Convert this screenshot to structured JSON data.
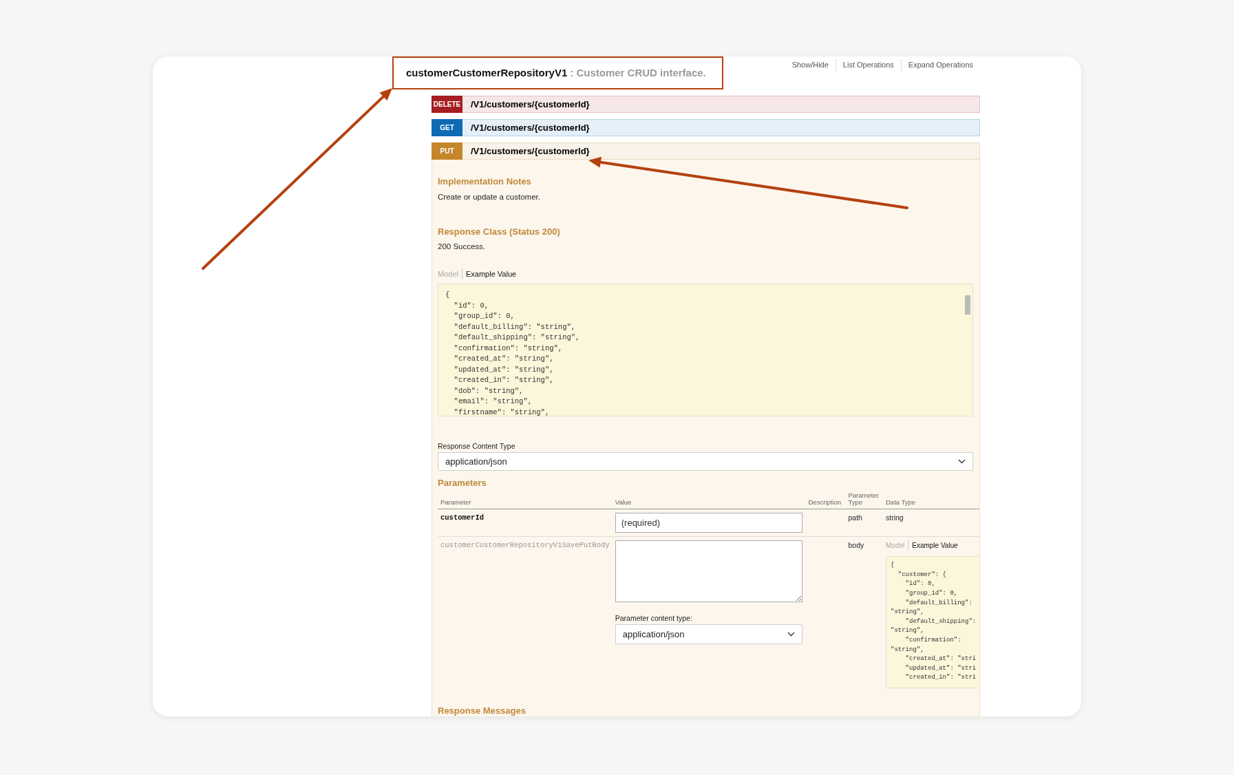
{
  "header": {
    "title": "customerCustomerRepositoryV1",
    "description": ": Customer CRUD interface.",
    "links": [
      "Show/Hide",
      "List Operations",
      "Expand Operations"
    ]
  },
  "operations": [
    {
      "method": "DELETE",
      "color": "#a41e22",
      "path": "/V1/customers/{customerId}",
      "expanded": false
    },
    {
      "method": "GET",
      "color": "#0f6ab4",
      "path": "/V1/customers/{customerId}",
      "expanded": false
    },
    {
      "method": "PUT",
      "color": "#c5862b",
      "path": "/V1/customers/{customerId}",
      "expanded": true
    }
  ],
  "details": {
    "implementation_notes": {
      "heading": "Implementation Notes",
      "text": "Create or update a customer."
    },
    "response_class": {
      "heading": "Response Class (Status 200)",
      "text": "200 Success."
    },
    "model_tabs": [
      {
        "label": "Model",
        "selected": false
      },
      {
        "label": "Example Value",
        "selected": true
      }
    ],
    "example_lines": [
      "{",
      "  \"id\": 0,",
      "  \"group_id\": 0,",
      "  \"default_billing\": \"string\",",
      "  \"default_shipping\": \"string\",",
      "  \"confirmation\": \"string\",",
      "  \"created_at\": \"string\",",
      "  \"updated_at\": \"string\",",
      "  \"created_in\": \"string\",",
      "  \"dob\": \"string\",",
      "  \"email\": \"string\",",
      "  \"firstname\": \"string\","
    ],
    "response_content_type": {
      "label": "Response Content Type",
      "value": "application/json"
    },
    "parameters": {
      "heading": "Parameters",
      "columns": [
        "Parameter",
        "Value",
        "Description",
        "Parameter Type",
        "Data Type"
      ],
      "rows": [
        {
          "kind": "input",
          "name": "customerId",
          "required": true,
          "placeholder": "(required)",
          "parameter_type": "path",
          "data_type": "string"
        },
        {
          "kind": "body",
          "name": "customerCustomerRepositoryV1SavePutBody",
          "required": false,
          "content_type_label": "Parameter content type:",
          "content_type": "application/json",
          "parameter_type": "body",
          "model_tabs": [
            {
              "label": "Model",
              "selected": false
            },
            {
              "label": "Example Value",
              "selected": true
            }
          ],
          "example_lines": [
            "{",
            "  \"customer\": {",
            "    \"id\": 0,",
            "    \"group_id\": 0,",
            "    \"default_billing\":",
            "\"string\",",
            "    \"default_shipping\":",
            "\"string\",",
            "    \"confirmation\":",
            "\"string\",",
            "    \"created_at\": \"stri",
            "    \"updated_at\": \"stri",
            "    \"created_in\": \"stri"
          ]
        }
      ]
    },
    "response_messages_heading": "Response Messages"
  }
}
